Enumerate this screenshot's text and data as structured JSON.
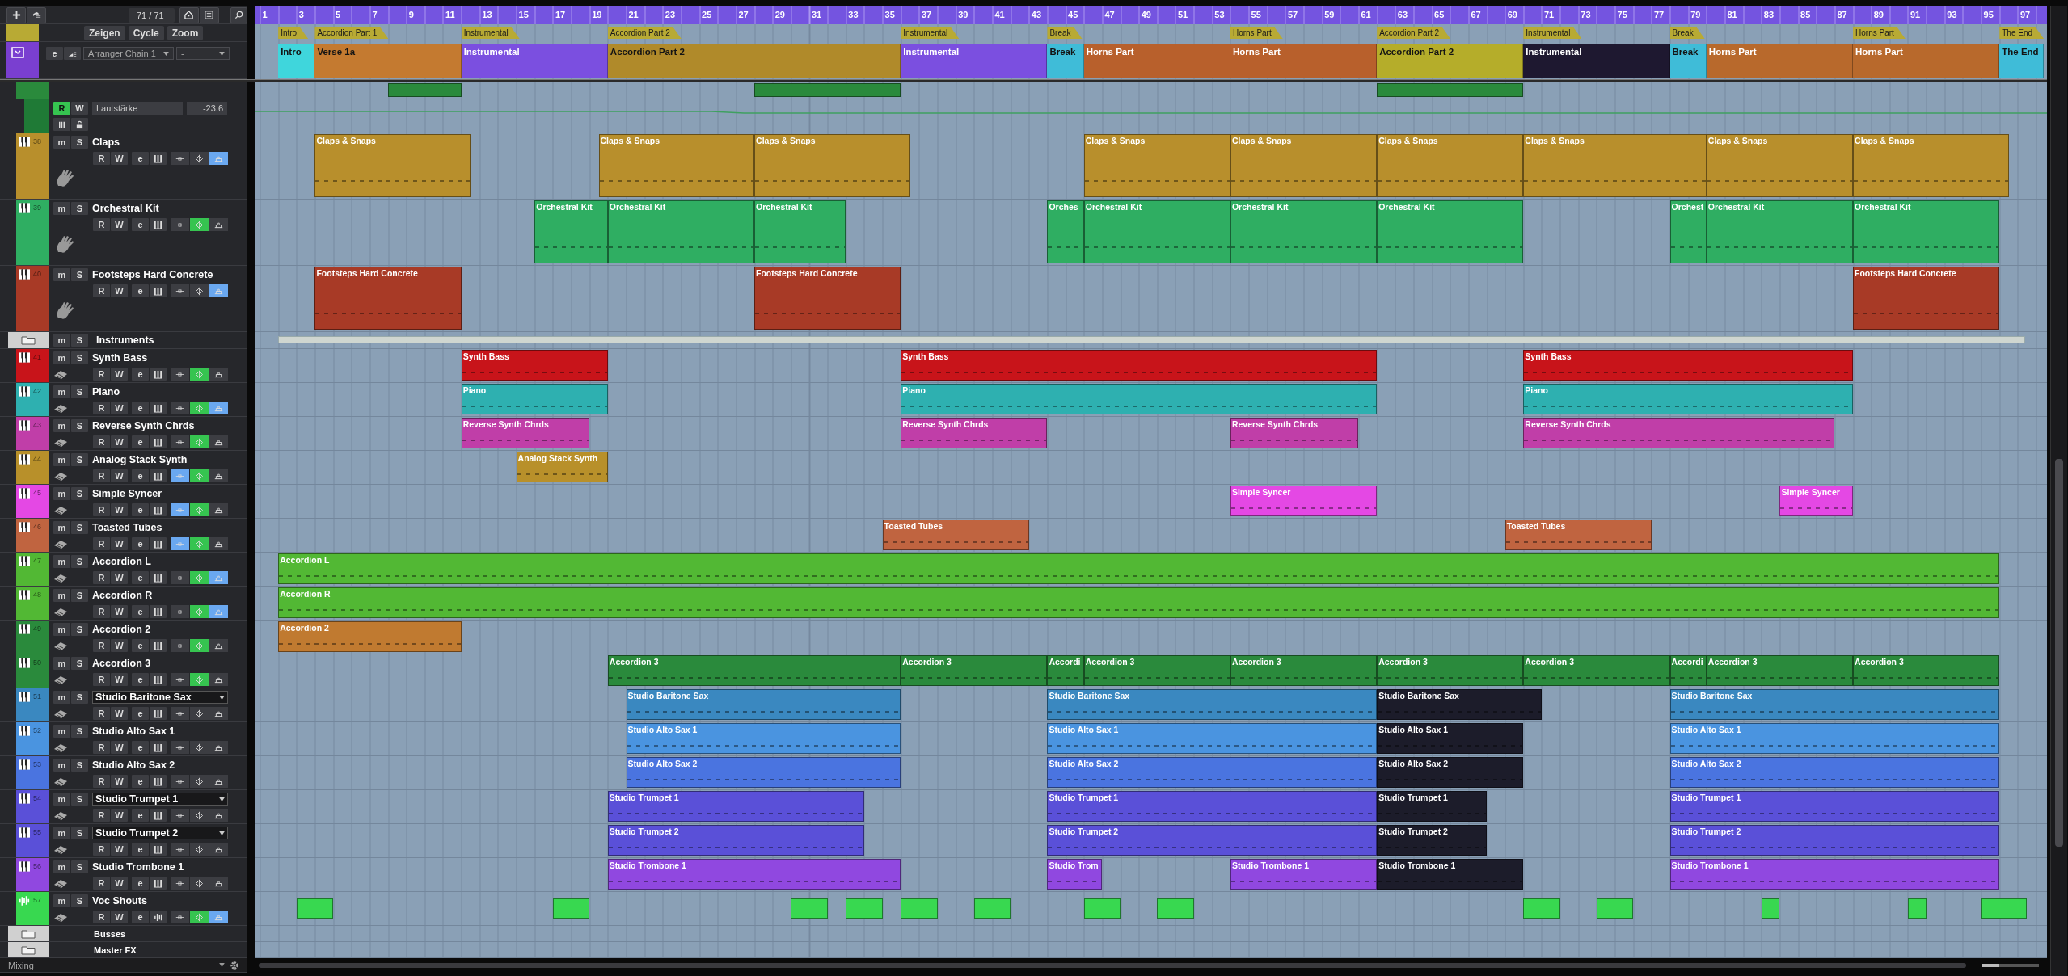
{
  "toolbar": {
    "counter": "71 / 71"
  },
  "arranger_controls": {
    "buttons": [
      "Zeigen",
      "Cycle",
      "Zoom"
    ],
    "edit": "e",
    "chain": "Arranger Chain 1",
    "chain_2": "-"
  },
  "ruler": [
    "1",
    "3",
    "5",
    "7",
    "9",
    "11",
    "13",
    "15",
    "17",
    "19",
    "21",
    "23",
    "25",
    "27",
    "29",
    "31",
    "33",
    "35",
    "37",
    "39",
    "41",
    "43",
    "45",
    "47",
    "49",
    "51",
    "53",
    "55",
    "57",
    "59",
    "61",
    "63",
    "65",
    "67",
    "69",
    "71",
    "73",
    "75",
    "77",
    "79",
    "81",
    "83",
    "85",
    "87",
    "89",
    "91",
    "93",
    "95",
    "97"
  ],
  "markers": [
    {
      "label": "Intro"
    },
    {
      "label": "Accordion Part 1"
    },
    {
      "label": "Instrumental"
    },
    {
      "label": "Accordion Part 2"
    },
    {
      "label": "Instrumental"
    },
    {
      "label": "Break"
    },
    {
      "label": "Horns Part"
    },
    {
      "label": "Accordion Part 2"
    },
    {
      "label": "Instrumental"
    },
    {
      "label": "Break"
    },
    {
      "label": "Horns Part"
    },
    {
      "label": "The End"
    }
  ],
  "arranger_events": [
    {
      "label": "Intro",
      "color": "#3fd6dc"
    },
    {
      "label": "Verse 1a",
      "color": "#c47a30"
    },
    {
      "label": "Instrumental",
      "color": "#7b4fe0"
    },
    {
      "label": "Accordion Part 2",
      "color": "#b08a2a"
    },
    {
      "label": "Instrumental",
      "color": "#7b4fe0"
    },
    {
      "label": "Break",
      "color": "#3fbcd8"
    },
    {
      "label": "Horns Part",
      "color": "#b8602c"
    },
    {
      "label": "Horns Part",
      "color": "#b8602c"
    },
    {
      "label": "Accordion Part 2",
      "color": "#b5ad2a"
    },
    {
      "label": "Instrumental",
      "color": "#1e1830"
    },
    {
      "label": "Break",
      "color": "#3fbcd8"
    },
    {
      "label": "Horns Part",
      "color": "#b8692c"
    },
    {
      "label": "Horns Part",
      "color": "#b8692c"
    },
    {
      "label": "The End",
      "color": "#3fbcd8"
    }
  ],
  "tracks": [
    {
      "kind": "partial",
      "color": "#2a8a3c"
    },
    {
      "kind": "automation",
      "color": "#1f7a36",
      "read": "R",
      "write": "W",
      "read_on": true,
      "write_on": false,
      "parameter": "Lautstärke",
      "value": "-23.6"
    },
    {
      "kind": "instrument",
      "number": "38",
      "name": "Claps",
      "color": "#b88f2c",
      "tall": true,
      "name_box": false,
      "mute": "m",
      "solo": "S",
      "read": "R",
      "write": "W",
      "edit": "e",
      "toggle_a": false,
      "toggle_b": false,
      "toggle_c": true,
      "clips": [
        {
          "label": "Claps & Snaps"
        },
        {
          "label": "Claps & Snaps"
        },
        {
          "label": "Claps & Snaps"
        },
        {
          "label": "Claps & Snaps"
        },
        {
          "label": "Claps & Snaps"
        },
        {
          "label": "Claps & Snaps"
        },
        {
          "label": "Claps & Snaps"
        },
        {
          "label": "Claps & Snaps"
        },
        {
          "label": "Claps & Snaps"
        }
      ]
    },
    {
      "kind": "instrument",
      "number": "39",
      "name": "Orchestral Kit",
      "color": "#2fae62",
      "tall": true,
      "name_box": false,
      "mute": "m",
      "solo": "S",
      "read": "R",
      "write": "W",
      "edit": "e",
      "toggle_a": false,
      "toggle_b": true,
      "toggle_c": false,
      "clips": [
        {
          "label": "Orchestral Kit"
        },
        {
          "label": "Orchestral Kit"
        },
        {
          "label": "Orchestral Kit"
        },
        {
          "label": "Orches"
        },
        {
          "label": "Orchestral Kit"
        },
        {
          "label": "Orchestral Kit"
        },
        {
          "label": "Orchestral Kit"
        },
        {
          "label": "Orchest"
        },
        {
          "label": "Orchestral Kit"
        },
        {
          "label": "Orchestral Kit"
        }
      ]
    },
    {
      "kind": "instrument",
      "number": "40",
      "name": "Footsteps Hard Concrete",
      "color": "#a83a26",
      "tall": true,
      "name_box": false,
      "mute": "m",
      "solo": "S",
      "read": "R",
      "write": "W",
      "edit": "e",
      "toggle_a": false,
      "toggle_b": false,
      "toggle_c": true,
      "clips": [
        {
          "label": "Footsteps Hard Concrete"
        },
        {
          "label": "Footsteps Hard Concrete"
        },
        {
          "label": "Footsteps Hard Concrete"
        }
      ]
    },
    {
      "kind": "folder",
      "name": "Instruments",
      "mute": "m",
      "solo": "S"
    },
    {
      "kind": "instrument",
      "number": "41",
      "name": "Synth Bass",
      "color": "#c8141a",
      "tall": false,
      "name_box": false,
      "mute": "m",
      "solo": "S",
      "read": "R",
      "write": "W",
      "edit": "e",
      "toggle_a": false,
      "toggle_b": true,
      "toggle_c": false,
      "clips": [
        {
          "label": "Synth Bass"
        },
        {
          "label": "Synth Bass"
        },
        {
          "label": "Synth Bass"
        }
      ]
    },
    {
      "kind": "instrument",
      "number": "42",
      "name": "Piano",
      "color": "#2eb0b0",
      "tall": false,
      "name_box": false,
      "mute": "m",
      "solo": "S",
      "read": "R",
      "write": "W",
      "edit": "e",
      "toggle_a": false,
      "toggle_b": true,
      "toggle_c": true,
      "clips": [
        {
          "label": "Piano"
        },
        {
          "label": "Piano"
        },
        {
          "label": "Piano"
        }
      ]
    },
    {
      "kind": "instrument",
      "number": "43",
      "name": "Reverse Synth Chrds",
      "color": "#c03ea8",
      "tall": false,
      "name_box": false,
      "mute": "m",
      "solo": "S",
      "read": "R",
      "write": "W",
      "edit": "e",
      "toggle_a": false,
      "toggle_b": true,
      "toggle_c": false,
      "clips": [
        {
          "label": "Reverse Synth Chrds"
        },
        {
          "label": "Reverse Synth Chrds"
        },
        {
          "label": "Reverse Synth Chrds"
        },
        {
          "label": "Reverse Synth Chrds"
        }
      ]
    },
    {
      "kind": "instrument",
      "number": "44",
      "name": "Analog Stack Synth",
      "color": "#b8902a",
      "tall": false,
      "name_box": false,
      "mute": "m",
      "solo": "S",
      "read": "R",
      "write": "W",
      "edit": "e",
      "toggle_a": true,
      "toggle_b": true,
      "toggle_c": false,
      "clips": [
        {
          "label": "Analog Stack Synth"
        }
      ]
    },
    {
      "kind": "instrument",
      "number": "45",
      "name": "Simple Syncer",
      "color": "#e448e4",
      "tall": false,
      "name_box": false,
      "mute": "m",
      "solo": "S",
      "read": "R",
      "write": "W",
      "edit": "e",
      "toggle_a": true,
      "toggle_b": true,
      "toggle_c": false,
      "clips": [
        {
          "label": "Simple Syncer"
        },
        {
          "label": "Simple Syncer"
        }
      ]
    },
    {
      "kind": "instrument",
      "number": "46",
      "name": "Toasted Tubes",
      "color": "#c06440",
      "tall": false,
      "name_box": false,
      "mute": "m",
      "solo": "S",
      "read": "R",
      "write": "W",
      "edit": "e",
      "toggle_a": true,
      "toggle_b": true,
      "toggle_c": false,
      "clips": [
        {
          "label": "Toasted Tubes"
        },
        {
          "label": "Toasted Tubes"
        }
      ]
    },
    {
      "kind": "instrument",
      "number": "47",
      "name": "Accordion L",
      "color": "#52b834",
      "tall": false,
      "name_box": false,
      "mute": "m",
      "solo": "S",
      "read": "R",
      "write": "W",
      "edit": "e",
      "toggle_a": false,
      "toggle_b": true,
      "toggle_c": true,
      "clips": [
        {
          "label": "Accordion L"
        }
      ]
    },
    {
      "kind": "instrument",
      "number": "48",
      "name": "Accordion R",
      "color": "#52b834",
      "tall": false,
      "name_box": false,
      "mute": "m",
      "solo": "S",
      "read": "R",
      "write": "W",
      "edit": "e",
      "toggle_a": false,
      "toggle_b": true,
      "toggle_c": true,
      "clips": [
        {
          "label": "Accordion R"
        }
      ]
    },
    {
      "kind": "instrument",
      "number": "49",
      "name": "Accordion 2",
      "color": "#2a8a3c",
      "tall": false,
      "name_box": false,
      "mute": "m",
      "solo": "S",
      "read": "R",
      "write": "W",
      "edit": "e",
      "toggle_a": false,
      "toggle_b": true,
      "toggle_c": false,
      "clips": [
        {
          "label": "Accordion 2",
          "color": "#c07a30"
        }
      ]
    },
    {
      "kind": "instrument",
      "number": "50",
      "name": "Accordion 3",
      "color": "#2a8a3c",
      "tall": false,
      "name_box": false,
      "mute": "m",
      "solo": "S",
      "read": "R",
      "write": "W",
      "edit": "e",
      "toggle_a": false,
      "toggle_b": true,
      "toggle_c": false,
      "clips": [
        {
          "label": "Accordion 3"
        },
        {
          "label": "Accordion 3"
        },
        {
          "label": "Accordi"
        },
        {
          "label": "Accordion 3"
        },
        {
          "label": "Accordion 3"
        },
        {
          "label": "Accordion 3"
        },
        {
          "label": "Accordion 3"
        },
        {
          "label": "Accordi"
        },
        {
          "label": "Accordion 3"
        },
        {
          "label": "Accordion 3"
        }
      ]
    },
    {
      "kind": "instrument",
      "number": "51",
      "name": "Studio Baritone Sax",
      "color": "#3a88c0",
      "tall": false,
      "name_box": true,
      "mute": "m",
      "solo": "S",
      "read": "R",
      "write": "W",
      "edit": "e",
      "toggle_a": false,
      "toggle_b": false,
      "toggle_c": false,
      "clips": [
        {
          "label": "Studio Baritone Sax"
        },
        {
          "label": "Studio Baritone Sax"
        },
        {
          "label": "Studio Baritone Sax",
          "color": "#1c1c2a"
        },
        {
          "label": "Studio Baritone Sax"
        }
      ]
    },
    {
      "kind": "instrument",
      "number": "52",
      "name": "Studio Alto Sax 1",
      "color": "#4a94e0",
      "tall": false,
      "name_box": false,
      "mute": "m",
      "solo": "S",
      "read": "R",
      "write": "W",
      "edit": "e",
      "toggle_a": false,
      "toggle_b": false,
      "toggle_c": false,
      "clips": [
        {
          "label": "Studio Alto Sax 1"
        },
        {
          "label": "Studio Alto Sax 1"
        },
        {
          "label": "Studio Alto Sax 1",
          "color": "#1c1c2a"
        },
        {
          "label": "Studio Alto Sax 1"
        }
      ]
    },
    {
      "kind": "instrument",
      "number": "53",
      "name": "Studio Alto Sax 2",
      "color": "#4a74e0",
      "tall": false,
      "name_box": false,
      "mute": "m",
      "solo": "S",
      "read": "R",
      "write": "W",
      "edit": "e",
      "toggle_a": false,
      "toggle_b": false,
      "toggle_c": false,
      "clips": [
        {
          "label": "Studio Alto Sax 2"
        },
        {
          "label": "Studio Alto Sax 2"
        },
        {
          "label": "Studio Alto Sax 2",
          "color": "#1c1c2a"
        },
        {
          "label": "Studio Alto Sax 2"
        }
      ]
    },
    {
      "kind": "instrument",
      "number": "54",
      "name": "Studio Trumpet 1",
      "color": "#5a50d8",
      "tall": false,
      "name_box": true,
      "mute": "m",
      "solo": "S",
      "read": "R",
      "write": "W",
      "edit": "e",
      "toggle_a": false,
      "toggle_b": false,
      "toggle_c": false,
      "clips": [
        {
          "label": "Studio Trumpet 1"
        },
        {
          "label": "Studio Trumpet 1"
        },
        {
          "label": "Studio Trumpet 1",
          "color": "#1c1c2a"
        },
        {
          "label": "Studio Trumpet 1"
        }
      ]
    },
    {
      "kind": "instrument",
      "number": "55",
      "name": "Studio Trumpet 2",
      "color": "#5a50d8",
      "tall": false,
      "name_box": true,
      "mute": "m",
      "solo": "S",
      "read": "R",
      "write": "W",
      "edit": "e",
      "toggle_a": false,
      "toggle_b": false,
      "toggle_c": false,
      "clips": [
        {
          "label": "Studio Trumpet 2"
        },
        {
          "label": "Studio Trumpet 2"
        },
        {
          "label": "Studio Trumpet 2",
          "color": "#1c1c2a"
        },
        {
          "label": "Studio Trumpet 2"
        }
      ]
    },
    {
      "kind": "instrument",
      "number": "56",
      "name": "Studio Trombone 1",
      "color": "#9048e0",
      "tall": false,
      "name_box": false,
      "mute": "m",
      "solo": "S",
      "read": "R",
      "write": "W",
      "edit": "e",
      "toggle_a": false,
      "toggle_b": false,
      "toggle_c": false,
      "clips": [
        {
          "label": "Studio Trombone 1"
        },
        {
          "label": "Studio Trom"
        },
        {
          "label": "Studio Trombone 1"
        },
        {
          "label": "Studio Trombone 1",
          "color": "#1c1c2a"
        },
        {
          "label": "Studio Trombone 1"
        }
      ]
    },
    {
      "kind": "audio",
      "number": "57",
      "name": "Voc Shouts",
      "color": "#38d850",
      "tall": false,
      "name_box": false,
      "mute": "m",
      "solo": "S",
      "read": "R",
      "write": "W",
      "edit": "e",
      "toggle_a": false,
      "toggle_b": true,
      "toggle_c": true
    },
    {
      "kind": "bus",
      "name": "Busses"
    },
    {
      "kind": "bus",
      "name": "Master FX"
    }
  ],
  "status_bar": {
    "label": "Mixing",
    "zoom": {
      "level": 0.3
    }
  }
}
